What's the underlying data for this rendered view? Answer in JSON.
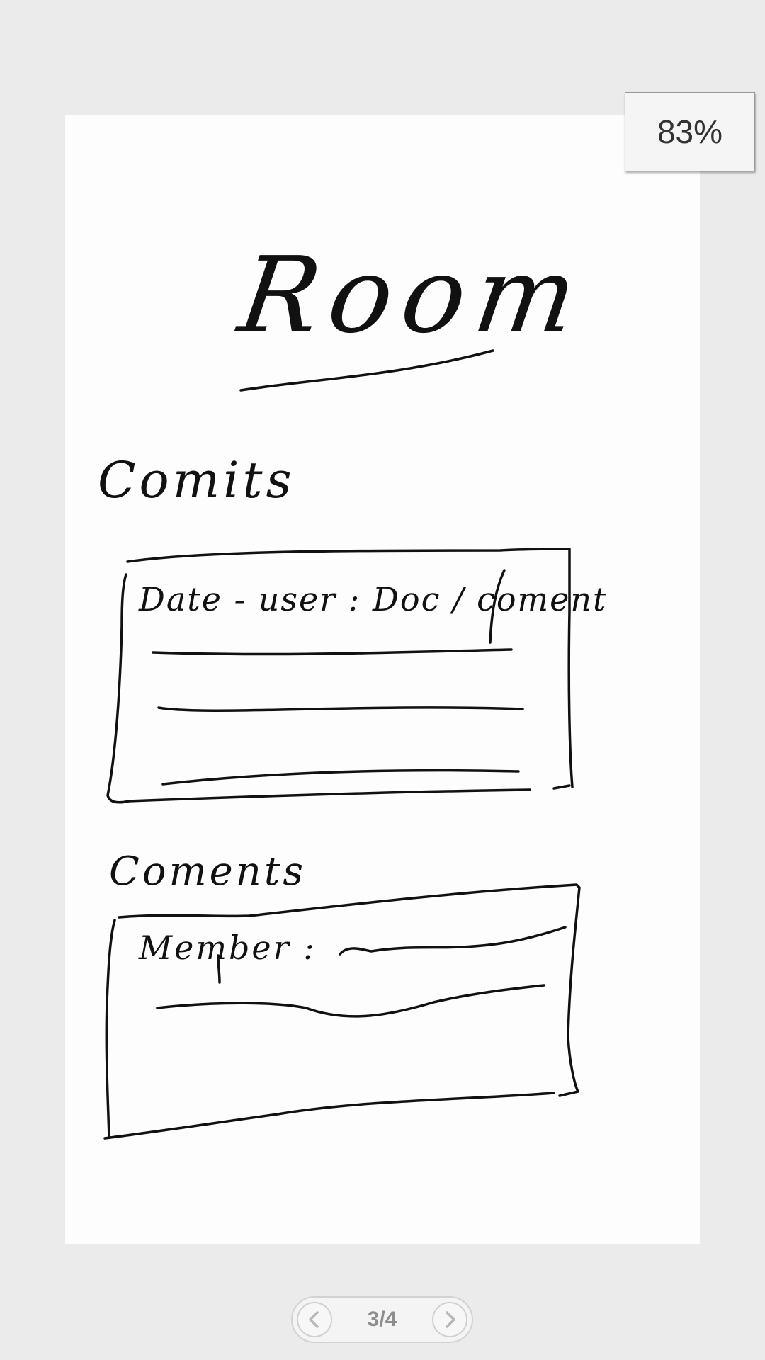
{
  "viewer": {
    "zoom": "83%",
    "page_indicator": "3/4",
    "prev_icon": "chevron-left-icon",
    "next_icon": "chevron-right-icon"
  },
  "sketch": {
    "title": "Room",
    "section_1": "Comits",
    "section_1_row_header": "Date - user :  Doc / coment",
    "section_2": "Coments",
    "section_2_row": "Member :"
  }
}
